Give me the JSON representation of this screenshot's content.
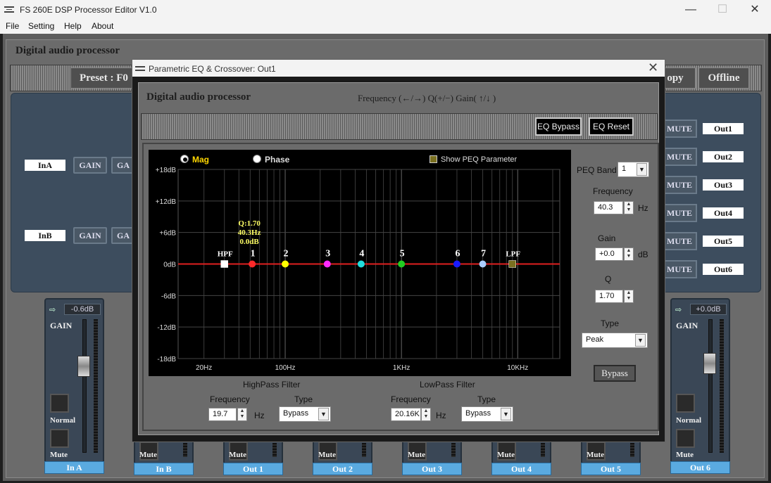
{
  "window": {
    "title": "FS 260E DSP Processor Editor V1.0",
    "minimize": "—",
    "maximize": "☐",
    "close": "✕"
  },
  "menu": [
    "File",
    "Setting",
    "Help",
    "About"
  ],
  "background": {
    "heading": "Digital audio processor",
    "preset_label": "Preset : F0",
    "copy_label": "opy",
    "offline_label": "Offline",
    "inputs": [
      {
        "label": "InA",
        "gain": "GAIN",
        "gain2": "GA"
      },
      {
        "label": "InB",
        "gain": "GAIN",
        "gain2": "GA"
      }
    ],
    "mute_label": "MUTE",
    "outputs": [
      "Out1",
      "Out2",
      "Out3",
      "Out4",
      "Out5",
      "Out6"
    ],
    "strips": [
      {
        "name": "In A",
        "db": "-0.6dB",
        "gain": "GAIN",
        "normal": "Normal",
        "mute": "Mute"
      },
      {
        "name": "Out 6",
        "db": "+0.0dB",
        "gain": "GAIN",
        "normal": "Normal",
        "mute": "Mute"
      }
    ],
    "mini_strips": [
      {
        "name": "In B",
        "mute": "Mute"
      },
      {
        "name": "Out 1",
        "mute": "Mute"
      },
      {
        "name": "Out 2",
        "mute": "Mute"
      },
      {
        "name": "Out 3",
        "mute": "Mute"
      },
      {
        "name": "Out 4",
        "mute": "Mute"
      },
      {
        "name": "Out 5",
        "mute": "Mute"
      }
    ]
  },
  "dialog": {
    "title": "Parametric EQ & Crossover: Out1",
    "close": "✕",
    "heading": "Digital audio processor",
    "hint": "Frequency (←/→) Q(+/−) Gain( ↑/↓ )",
    "eq_bypass": "EQ Bypass",
    "eq_reset": "EQ Reset",
    "graph": {
      "mag_label": "Mag",
      "phase_label": "Phase",
      "show_peq_label": "Show PEQ Parameter",
      "selected_mode": "Mag",
      "tooltip": {
        "q": "Q:1.70",
        "freq": "40.3Hz",
        "gain": "0.0dB"
      },
      "y_ticks": [
        "+18dB",
        "+12dB",
        "+6dB",
        "0dB",
        "-6dB",
        "-12dB",
        "-18dB"
      ],
      "x_ticks": [
        "20Hz",
        "100Hz",
        "1KHz",
        "10KHz"
      ],
      "curve_color": "#e02020",
      "points": [
        {
          "label": "HPF",
          "freq_hz": 30,
          "color": "#ffffff",
          "shape": "square"
        },
        {
          "label": "1",
          "freq_hz": 52,
          "color": "#ff2a2a",
          "shape": "circle"
        },
        {
          "label": "2",
          "freq_hz": 100,
          "color": "#ffff00",
          "shape": "circle"
        },
        {
          "label": "3",
          "freq_hz": 230,
          "color": "#ff2aff",
          "shape": "circle"
        },
        {
          "label": "4",
          "freq_hz": 450,
          "color": "#22dddd",
          "shape": "circle"
        },
        {
          "label": "5",
          "freq_hz": 1000,
          "color": "#22cc22",
          "shape": "circle"
        },
        {
          "label": "6",
          "freq_hz": 3000,
          "color": "#1a1aff",
          "shape": "circle"
        },
        {
          "label": "7",
          "freq_hz": 5000,
          "color": "#aaccff",
          "shape": "circle"
        },
        {
          "label": "LPF",
          "freq_hz": 9000,
          "color": "#7a7020",
          "shape": "square"
        }
      ]
    },
    "peq": {
      "band_label": "PEQ Band",
      "band_value": "1",
      "frequency_label": "Frequency",
      "frequency_value": "40.3",
      "frequency_unit": "Hz",
      "gain_label": "Gain",
      "gain_value": "+0.0",
      "gain_unit": "dB",
      "q_label": "Q",
      "q_value": "1.70",
      "type_label": "Type",
      "type_value": "Peak",
      "bypass_label": "Bypass"
    },
    "highpass": {
      "title": "HighPass Filter",
      "frequency_label": "Frequency",
      "frequency_value": "19.7",
      "unit": "Hz",
      "type_label": "Type",
      "type_value": "Bypass"
    },
    "lowpass": {
      "title": "LowPass Filter",
      "frequency_label": "Frequency",
      "frequency_value": "20.16K",
      "unit": "Hz",
      "type_label": "Type",
      "type_value": "Bypass"
    }
  }
}
